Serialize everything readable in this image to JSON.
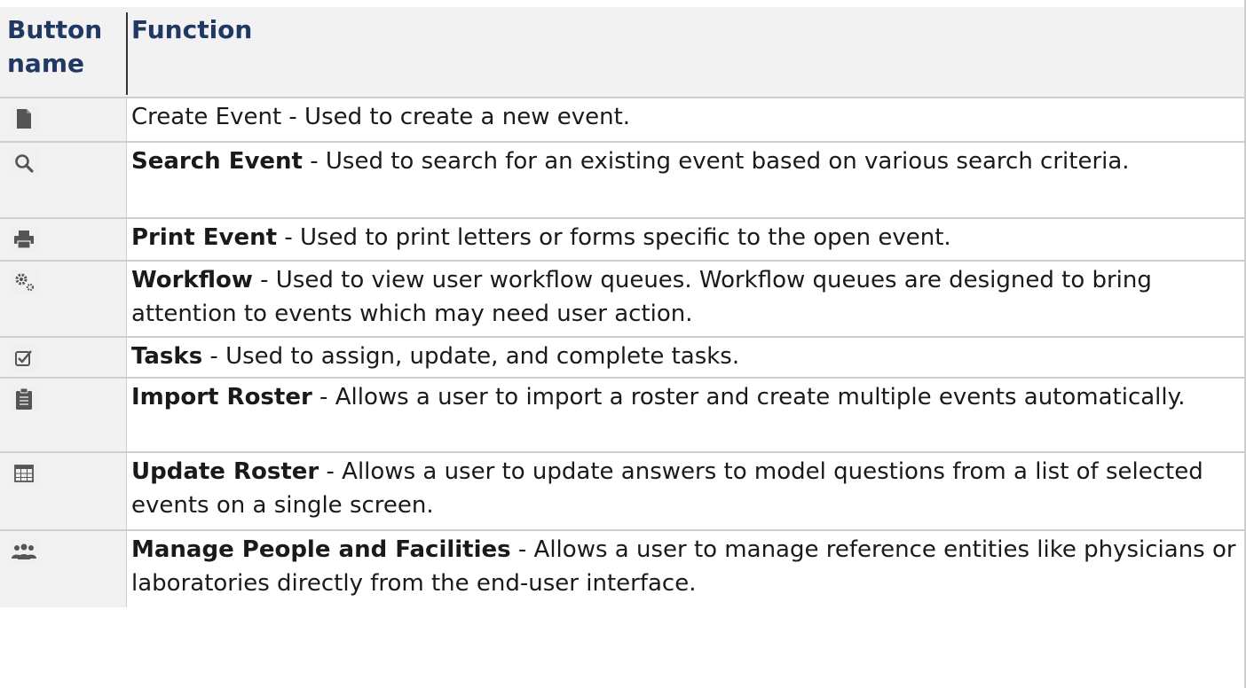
{
  "header": {
    "col1": "Button name",
    "col2": "Function"
  },
  "rows": [
    {
      "icon": "document-icon",
      "name": "",
      "desc": "Create Event - Used to create a new event."
    },
    {
      "icon": "search-icon",
      "name": "Search Event",
      "desc": " - Used to search for an existing event based on various search criteria."
    },
    {
      "icon": "printer-icon",
      "name": "Print Event",
      "desc": " - Used to print letters or forms specific to the open event."
    },
    {
      "icon": "gears-icon",
      "name": "Workflow",
      "desc": " - Used to view user workflow queues. Workflow queues are designed to bring attention to events which may need user action."
    },
    {
      "icon": "checkbox-icon",
      "name": "Tasks",
      "desc": " - Used to assign, update, and complete tasks."
    },
    {
      "icon": "clipboard-icon",
      "name": "Import Roster",
      "desc": " - Allows a user to import a roster and create multiple events automatically."
    },
    {
      "icon": "table-icon",
      "name": "Update Roster",
      "desc": " - Allows a user to update answers to model questions from a list of selected events on a single screen."
    },
    {
      "icon": "people-icon",
      "name": "Manage People and Facilities",
      "desc": " - Allows a user to manage reference entities like physicians or laboratories directly from the end-user interface."
    }
  ]
}
